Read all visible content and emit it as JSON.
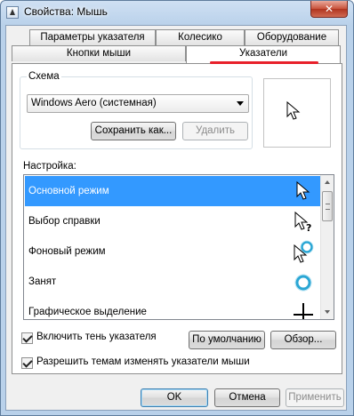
{
  "window": {
    "title": "Свойства: Мышь",
    "close_glyph": "✕"
  },
  "tabs": {
    "row1": [
      "Параметры указателя",
      "Колесико",
      "Оборудование"
    ],
    "row2": [
      "Кнопки мыши",
      "Указатели"
    ],
    "active": "Указатели"
  },
  "scheme": {
    "group_label": "Схема",
    "selected": "Windows Aero (системная)",
    "save_label": "Сохранить как...",
    "delete_label": "Удалить"
  },
  "customize": {
    "label": "Настройка:",
    "items": [
      {
        "label": "Основной режим",
        "icon": "arrow-cursor-icon",
        "selected": true
      },
      {
        "label": "Выбор справки",
        "icon": "help-cursor-icon",
        "selected": false
      },
      {
        "label": "Фоновый режим",
        "icon": "working-in-background-cursor-icon",
        "selected": false
      },
      {
        "label": "Занят",
        "icon": "busy-cursor-icon",
        "selected": false
      },
      {
        "label": "Графическое выделение",
        "icon": "precision-select-cursor-icon",
        "selected": false
      }
    ]
  },
  "options": {
    "shadow_label": "Включить тень указателя",
    "shadow_checked": true,
    "themes_label": "Разрешить темам изменять указатели мыши",
    "themes_checked": true,
    "default_label": "По умолчанию",
    "browse_label": "Обзор..."
  },
  "footer": {
    "ok_label": "OK",
    "cancel_label": "Отмена",
    "apply_label": "Применить"
  },
  "colors": {
    "selection": "#3399ff",
    "annotation_underline": "#e8202a"
  }
}
